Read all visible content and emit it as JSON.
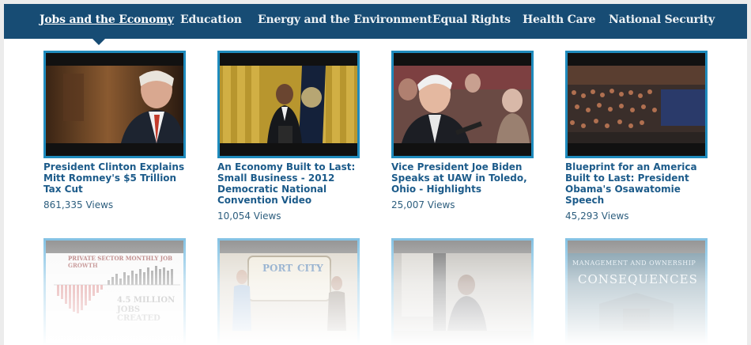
{
  "nav": {
    "items": [
      {
        "label": "Jobs and the Economy",
        "active": true
      },
      {
        "label": "Education",
        "active": false
      },
      {
        "label": "Energy and the Environment",
        "active": false
      },
      {
        "label": "Equal Rights",
        "active": false
      },
      {
        "label": "Health Care",
        "active": false
      },
      {
        "label": "National Security",
        "active": false
      }
    ]
  },
  "videos": [
    {
      "title": "President Clinton Explains Mitt Romney's $5 Trillion Tax Cut",
      "views": "861,335 Views"
    },
    {
      "title": "An Economy Built to Last: Small Business - 2012 Democratic National Convention Video",
      "views": "10,054 Views"
    },
    {
      "title": "Vice President Joe Biden Speaks at UAW in Toledo, Ohio - Highlights",
      "views": "25,007 Views"
    },
    {
      "title": "Blueprint for an America Built to Last: President Obama's Osawatomie Speech",
      "views": "45,293 Views"
    }
  ],
  "thumb_text": {
    "jobs_chart_title": "PRIVATE SECTOR MONTHLY JOB GROWTH",
    "jobs_chart_caption_1": "4.5 MILLION",
    "jobs_chart_caption_2": "JOBS CREATED",
    "port_city_1": "PORT",
    "port_city_2": "CITY",
    "mgmt_1": "MANAGEMENT AND OWNERSHIP",
    "mgmt_2": "CONSEQUENCES"
  },
  "colors": {
    "nav_background": "#174c74",
    "thumb_border": "#1f8bbd",
    "title_text": "#1c5b8a"
  }
}
